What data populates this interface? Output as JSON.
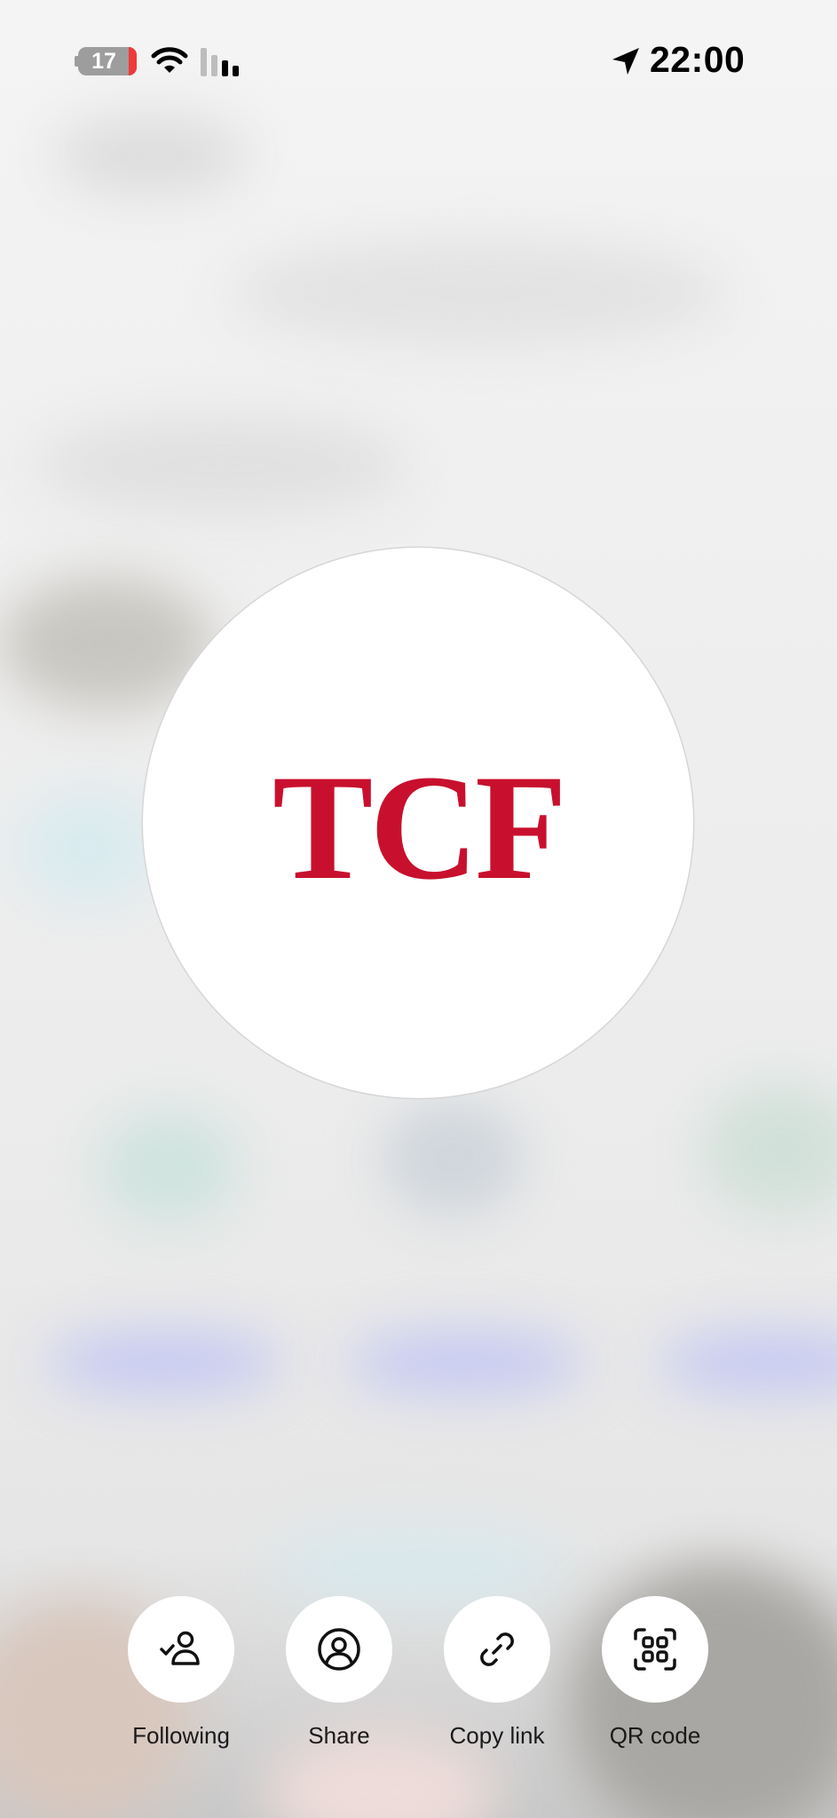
{
  "status_bar": {
    "battery_level": "17",
    "time": "22:00",
    "icons": [
      "battery-icon",
      "wifi-icon",
      "cellular-signal-icon",
      "location-arrow-icon"
    ]
  },
  "profile": {
    "logo_text": "TCF",
    "logo_color": "#c8102e"
  },
  "actions": [
    {
      "label": "Following",
      "icon": "person-check-icon"
    },
    {
      "label": "Share",
      "icon": "person-circle-icon"
    },
    {
      "label": "Copy link",
      "icon": "link-icon"
    },
    {
      "label": "QR code",
      "icon": "qr-code-icon"
    }
  ]
}
